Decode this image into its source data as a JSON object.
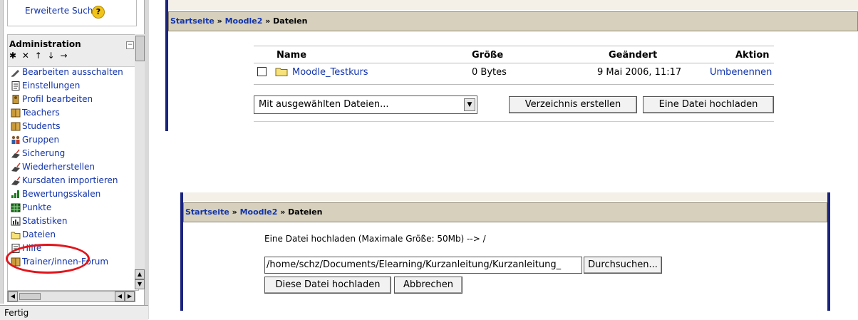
{
  "sidebar": {
    "search_link": "Erweiterte Suche",
    "admin_title": "Administration",
    "admin_controls": "✱ ✕ ↑ ↓ →",
    "items": [
      {
        "label": "Bearbeiten ausschalten",
        "icon": "edit-icon"
      },
      {
        "label": "Einstellungen",
        "icon": "settings-icon"
      },
      {
        "label": "Profil bearbeiten",
        "icon": "profile-icon"
      },
      {
        "label": "Teachers",
        "icon": "teachers-icon"
      },
      {
        "label": "Students",
        "icon": "students-icon"
      },
      {
        "label": "Gruppen",
        "icon": "groups-icon"
      },
      {
        "label": "Sicherung",
        "icon": "backup-icon"
      },
      {
        "label": "Wiederherstellen",
        "icon": "restore-icon"
      },
      {
        "label": "Kursdaten importieren",
        "icon": "import-icon"
      },
      {
        "label": "Bewertungsskalen",
        "icon": "scales-icon"
      },
      {
        "label": "Punkte",
        "icon": "grades-icon"
      },
      {
        "label": "Statistiken",
        "icon": "stats-icon"
      },
      {
        "label": "Dateien",
        "icon": "folder-icon"
      },
      {
        "label": "Hilfe",
        "icon": "help-icon"
      },
      {
        "label": "Trainer/innen-Forum",
        "icon": "forum-icon"
      }
    ],
    "status": "Fertig"
  },
  "top": {
    "breadcrumb": {
      "home": "Startseite",
      "sep1": " » ",
      "course": "Moodle2",
      "sep2": " » ",
      "current": "Dateien"
    },
    "table": {
      "headers": {
        "name": "Name",
        "size": "Größe",
        "modified": "Geändert",
        "action": "Aktion"
      },
      "rows": [
        {
          "name": "Moodle_Testkurs",
          "size": "0 Bytes",
          "modified": "9 Mai 2006, 11:17",
          "action": "Umbenennen"
        }
      ]
    },
    "select_action": "Mit ausgewählten Dateien...",
    "btn_mkdir": "Verzeichnis erstellen",
    "btn_upload": "Eine Datei hochladen"
  },
  "bottom": {
    "breadcrumb": {
      "home": "Startseite",
      "sep1": " » ",
      "course": "Moodle2",
      "sep2": " » ",
      "current": "Dateien"
    },
    "heading": "Eine Datei hochladen (Maximale Größe: 50Mb) --> /",
    "file_path": "/home/schz/Documents/Elearning/Kurzanleitung/Kurzanleitung_",
    "btn_browse": "Durchsuchen...",
    "btn_upload": "Diese Datei hochladen",
    "btn_cancel": "Abbrechen"
  },
  "colors": {
    "link": "#1133aa",
    "navbar": "#d6d0bd",
    "frame": "#1a237e",
    "highlight": "#e3141b"
  }
}
